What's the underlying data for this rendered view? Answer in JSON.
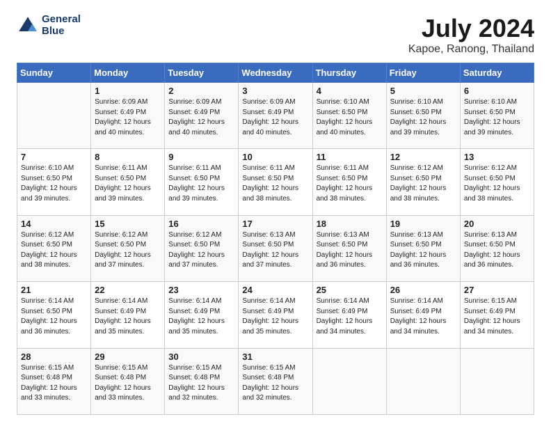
{
  "header": {
    "logo_line1": "General",
    "logo_line2": "Blue",
    "title": "July 2024",
    "subtitle": "Kapoe, Ranong, Thailand"
  },
  "days_of_week": [
    "Sunday",
    "Monday",
    "Tuesday",
    "Wednesday",
    "Thursday",
    "Friday",
    "Saturday"
  ],
  "weeks": [
    [
      {
        "day": "",
        "info": ""
      },
      {
        "day": "1",
        "info": "Sunrise: 6:09 AM\nSunset: 6:49 PM\nDaylight: 12 hours\nand 40 minutes."
      },
      {
        "day": "2",
        "info": "Sunrise: 6:09 AM\nSunset: 6:49 PM\nDaylight: 12 hours\nand 40 minutes."
      },
      {
        "day": "3",
        "info": "Sunrise: 6:09 AM\nSunset: 6:49 PM\nDaylight: 12 hours\nand 40 minutes."
      },
      {
        "day": "4",
        "info": "Sunrise: 6:10 AM\nSunset: 6:50 PM\nDaylight: 12 hours\nand 40 minutes."
      },
      {
        "day": "5",
        "info": "Sunrise: 6:10 AM\nSunset: 6:50 PM\nDaylight: 12 hours\nand 39 minutes."
      },
      {
        "day": "6",
        "info": "Sunrise: 6:10 AM\nSunset: 6:50 PM\nDaylight: 12 hours\nand 39 minutes."
      }
    ],
    [
      {
        "day": "7",
        "info": "Sunrise: 6:10 AM\nSunset: 6:50 PM\nDaylight: 12 hours\nand 39 minutes."
      },
      {
        "day": "8",
        "info": "Sunrise: 6:11 AM\nSunset: 6:50 PM\nDaylight: 12 hours\nand 39 minutes."
      },
      {
        "day": "9",
        "info": "Sunrise: 6:11 AM\nSunset: 6:50 PM\nDaylight: 12 hours\nand 39 minutes."
      },
      {
        "day": "10",
        "info": "Sunrise: 6:11 AM\nSunset: 6:50 PM\nDaylight: 12 hours\nand 38 minutes."
      },
      {
        "day": "11",
        "info": "Sunrise: 6:11 AM\nSunset: 6:50 PM\nDaylight: 12 hours\nand 38 minutes."
      },
      {
        "day": "12",
        "info": "Sunrise: 6:12 AM\nSunset: 6:50 PM\nDaylight: 12 hours\nand 38 minutes."
      },
      {
        "day": "13",
        "info": "Sunrise: 6:12 AM\nSunset: 6:50 PM\nDaylight: 12 hours\nand 38 minutes."
      }
    ],
    [
      {
        "day": "14",
        "info": "Sunrise: 6:12 AM\nSunset: 6:50 PM\nDaylight: 12 hours\nand 38 minutes."
      },
      {
        "day": "15",
        "info": "Sunrise: 6:12 AM\nSunset: 6:50 PM\nDaylight: 12 hours\nand 37 minutes."
      },
      {
        "day": "16",
        "info": "Sunrise: 6:12 AM\nSunset: 6:50 PM\nDaylight: 12 hours\nand 37 minutes."
      },
      {
        "day": "17",
        "info": "Sunrise: 6:13 AM\nSunset: 6:50 PM\nDaylight: 12 hours\nand 37 minutes."
      },
      {
        "day": "18",
        "info": "Sunrise: 6:13 AM\nSunset: 6:50 PM\nDaylight: 12 hours\nand 36 minutes."
      },
      {
        "day": "19",
        "info": "Sunrise: 6:13 AM\nSunset: 6:50 PM\nDaylight: 12 hours\nand 36 minutes."
      },
      {
        "day": "20",
        "info": "Sunrise: 6:13 AM\nSunset: 6:50 PM\nDaylight: 12 hours\nand 36 minutes."
      }
    ],
    [
      {
        "day": "21",
        "info": "Sunrise: 6:14 AM\nSunset: 6:50 PM\nDaylight: 12 hours\nand 36 minutes."
      },
      {
        "day": "22",
        "info": "Sunrise: 6:14 AM\nSunset: 6:49 PM\nDaylight: 12 hours\nand 35 minutes."
      },
      {
        "day": "23",
        "info": "Sunrise: 6:14 AM\nSunset: 6:49 PM\nDaylight: 12 hours\nand 35 minutes."
      },
      {
        "day": "24",
        "info": "Sunrise: 6:14 AM\nSunset: 6:49 PM\nDaylight: 12 hours\nand 35 minutes."
      },
      {
        "day": "25",
        "info": "Sunrise: 6:14 AM\nSunset: 6:49 PM\nDaylight: 12 hours\nand 34 minutes."
      },
      {
        "day": "26",
        "info": "Sunrise: 6:14 AM\nSunset: 6:49 PM\nDaylight: 12 hours\nand 34 minutes."
      },
      {
        "day": "27",
        "info": "Sunrise: 6:15 AM\nSunset: 6:49 PM\nDaylight: 12 hours\nand 34 minutes."
      }
    ],
    [
      {
        "day": "28",
        "info": "Sunrise: 6:15 AM\nSunset: 6:48 PM\nDaylight: 12 hours\nand 33 minutes."
      },
      {
        "day": "29",
        "info": "Sunrise: 6:15 AM\nSunset: 6:48 PM\nDaylight: 12 hours\nand 33 minutes."
      },
      {
        "day": "30",
        "info": "Sunrise: 6:15 AM\nSunset: 6:48 PM\nDaylight: 12 hours\nand 32 minutes."
      },
      {
        "day": "31",
        "info": "Sunrise: 6:15 AM\nSunset: 6:48 PM\nDaylight: 12 hours\nand 32 minutes."
      },
      {
        "day": "",
        "info": ""
      },
      {
        "day": "",
        "info": ""
      },
      {
        "day": "",
        "info": ""
      }
    ]
  ]
}
